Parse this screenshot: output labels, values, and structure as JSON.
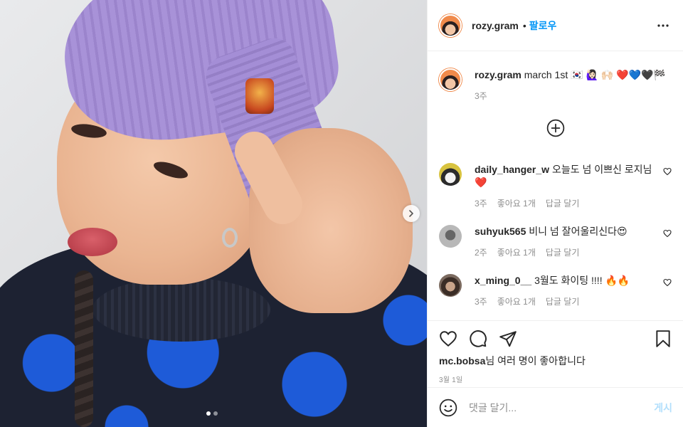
{
  "post": {
    "owner": {
      "username": "rozy.gram",
      "follow_label": "팔로우",
      "separator": "•"
    },
    "caption": {
      "username": "rozy.gram",
      "text": "march 1st 🇰🇷 🙋🏻‍♀️ 🙌🏻 ❤️💙🖤🏁",
      "time": "3주"
    },
    "comments": [
      {
        "username": "daily_hanger_w",
        "text": "오늘도 넘 이쁘신 로지님❤️",
        "time": "3주",
        "likes": "좋아요 1개",
        "reply": "답글 달기"
      },
      {
        "username": "suhyuk565",
        "text": "비니 넘 잘어울리신다😍",
        "time": "2주",
        "likes": "좋아요 1개",
        "reply": "답글 달기"
      },
      {
        "username": "x_ming_0__",
        "text": "3월도 화이팅 !!!! 🔥🔥",
        "time": "3주",
        "likes": "좋아요 1개",
        "reply": "답글 달기"
      }
    ],
    "likes": {
      "user": "mc.bobsa",
      "suffix": "님 여러 명이 좋아합니다"
    },
    "date": "3월 1일",
    "add_comment": {
      "placeholder": "댓글 달기...",
      "post_label": "게시"
    },
    "carousel": {
      "total": 2,
      "current": 1
    }
  },
  "icons": {
    "more": "more-horizontal-icon",
    "add": "plus-circle-icon",
    "heart": "heart-icon",
    "comment": "comment-icon",
    "share": "share-icon",
    "save": "bookmark-icon",
    "emoji": "emoji-icon",
    "next": "chevron-right-icon"
  },
  "colors": {
    "accent": "#0095f6",
    "muted": "#8e8e8e",
    "post_disabled": "#b2dffc"
  }
}
